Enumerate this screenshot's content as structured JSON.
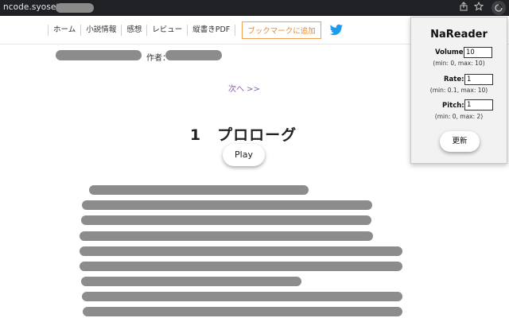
{
  "browser": {
    "url_prefix": "ncode.syosetu.com",
    "icons": [
      "share-icon",
      "star-icon",
      "extension-icon"
    ]
  },
  "nav": {
    "items": [
      "ホーム",
      "小説情報",
      "感想",
      "レビュー",
      "縦書きPDF"
    ],
    "bookmark": "ブックマークに追加",
    "twitter_icon": "twitter-icon"
  },
  "content": {
    "author_label": "作者：",
    "next_link": "次へ >>",
    "chapter_title": "1　プロローグ",
    "play_button": "Play"
  },
  "popup": {
    "title": "NaReader",
    "volume": {
      "label": "Volume:",
      "value": "10",
      "hint": "(min: 0, max: 10)"
    },
    "rate": {
      "label": "Rate:",
      "value": "1",
      "hint": "(min: 0.1, max: 10)"
    },
    "pitch": {
      "label": "Pitch:",
      "value": "1",
      "hint": "(min: 0, max: 2)"
    },
    "update_button": "更新"
  },
  "colors": {
    "topbar": "#202124",
    "bookmark_accent": "#f08a24",
    "link": "#8a5ea8",
    "twitter": "#1d9bf0",
    "redaction": "#8c8c8c"
  }
}
